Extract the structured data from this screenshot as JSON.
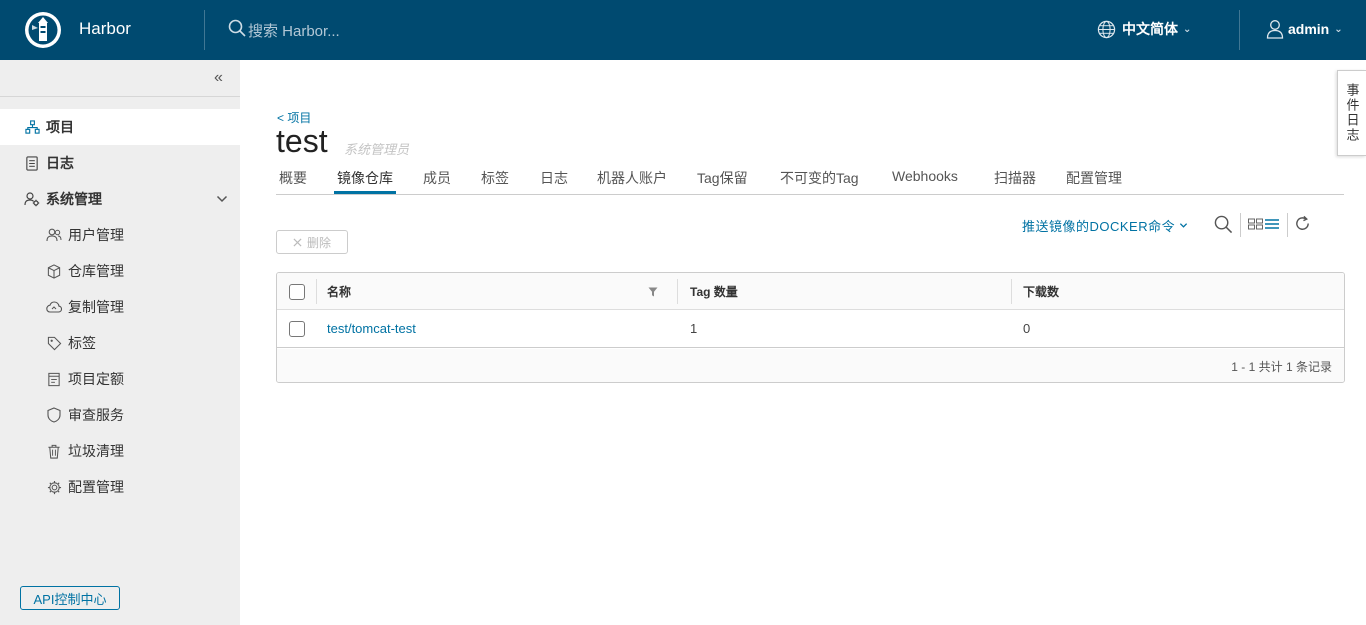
{
  "header": {
    "brand": "Harbor",
    "search_placeholder": "搜索 Harbor...",
    "language": "中文简体",
    "user": "admin"
  },
  "sidebar": {
    "items": [
      {
        "label": "项目",
        "icon": "projects-icon",
        "active": true
      },
      {
        "label": "日志",
        "icon": "log-icon"
      },
      {
        "label": "系统管理",
        "icon": "admin-icon"
      }
    ],
    "sub_items": [
      {
        "label": "用户管理",
        "icon": "users-icon"
      },
      {
        "label": "仓库管理",
        "icon": "registry-icon"
      },
      {
        "label": "复制管理",
        "icon": "replication-icon"
      },
      {
        "label": "标签",
        "icon": "tag-icon"
      },
      {
        "label": "项目定额",
        "icon": "quota-icon"
      },
      {
        "label": "审查服务",
        "icon": "shield-icon"
      },
      {
        "label": "垃圾清理",
        "icon": "trash-icon"
      },
      {
        "label": "配置管理",
        "icon": "gear-icon"
      }
    ],
    "api_button": "API控制中心"
  },
  "event_log_tab": "事件日志",
  "project": {
    "back_link": "< 项目",
    "name": "test",
    "role": "系统管理员"
  },
  "tabs": [
    "概要",
    "镜像仓库",
    "成员",
    "标签",
    "日志",
    "机器人账户",
    "Tag保留",
    "不可变的Tag",
    "Webhooks",
    "扫描器",
    "配置管理"
  ],
  "active_tab": "镜像仓库",
  "toolbar": {
    "push_command": "推送镜像的DOCKER命令",
    "delete_button": "删除"
  },
  "table": {
    "columns": [
      "名称",
      "Tag 数量",
      "下载数"
    ],
    "rows": [
      {
        "name": "test/tomcat-test",
        "tag_count": "1",
        "pulls": "0"
      }
    ],
    "footer": "1 - 1 共计 1 条记录"
  },
  "colors": {
    "header_bg": "#004a70",
    "accent": "#0072a3",
    "sidebar_bg": "#eeeeee"
  }
}
